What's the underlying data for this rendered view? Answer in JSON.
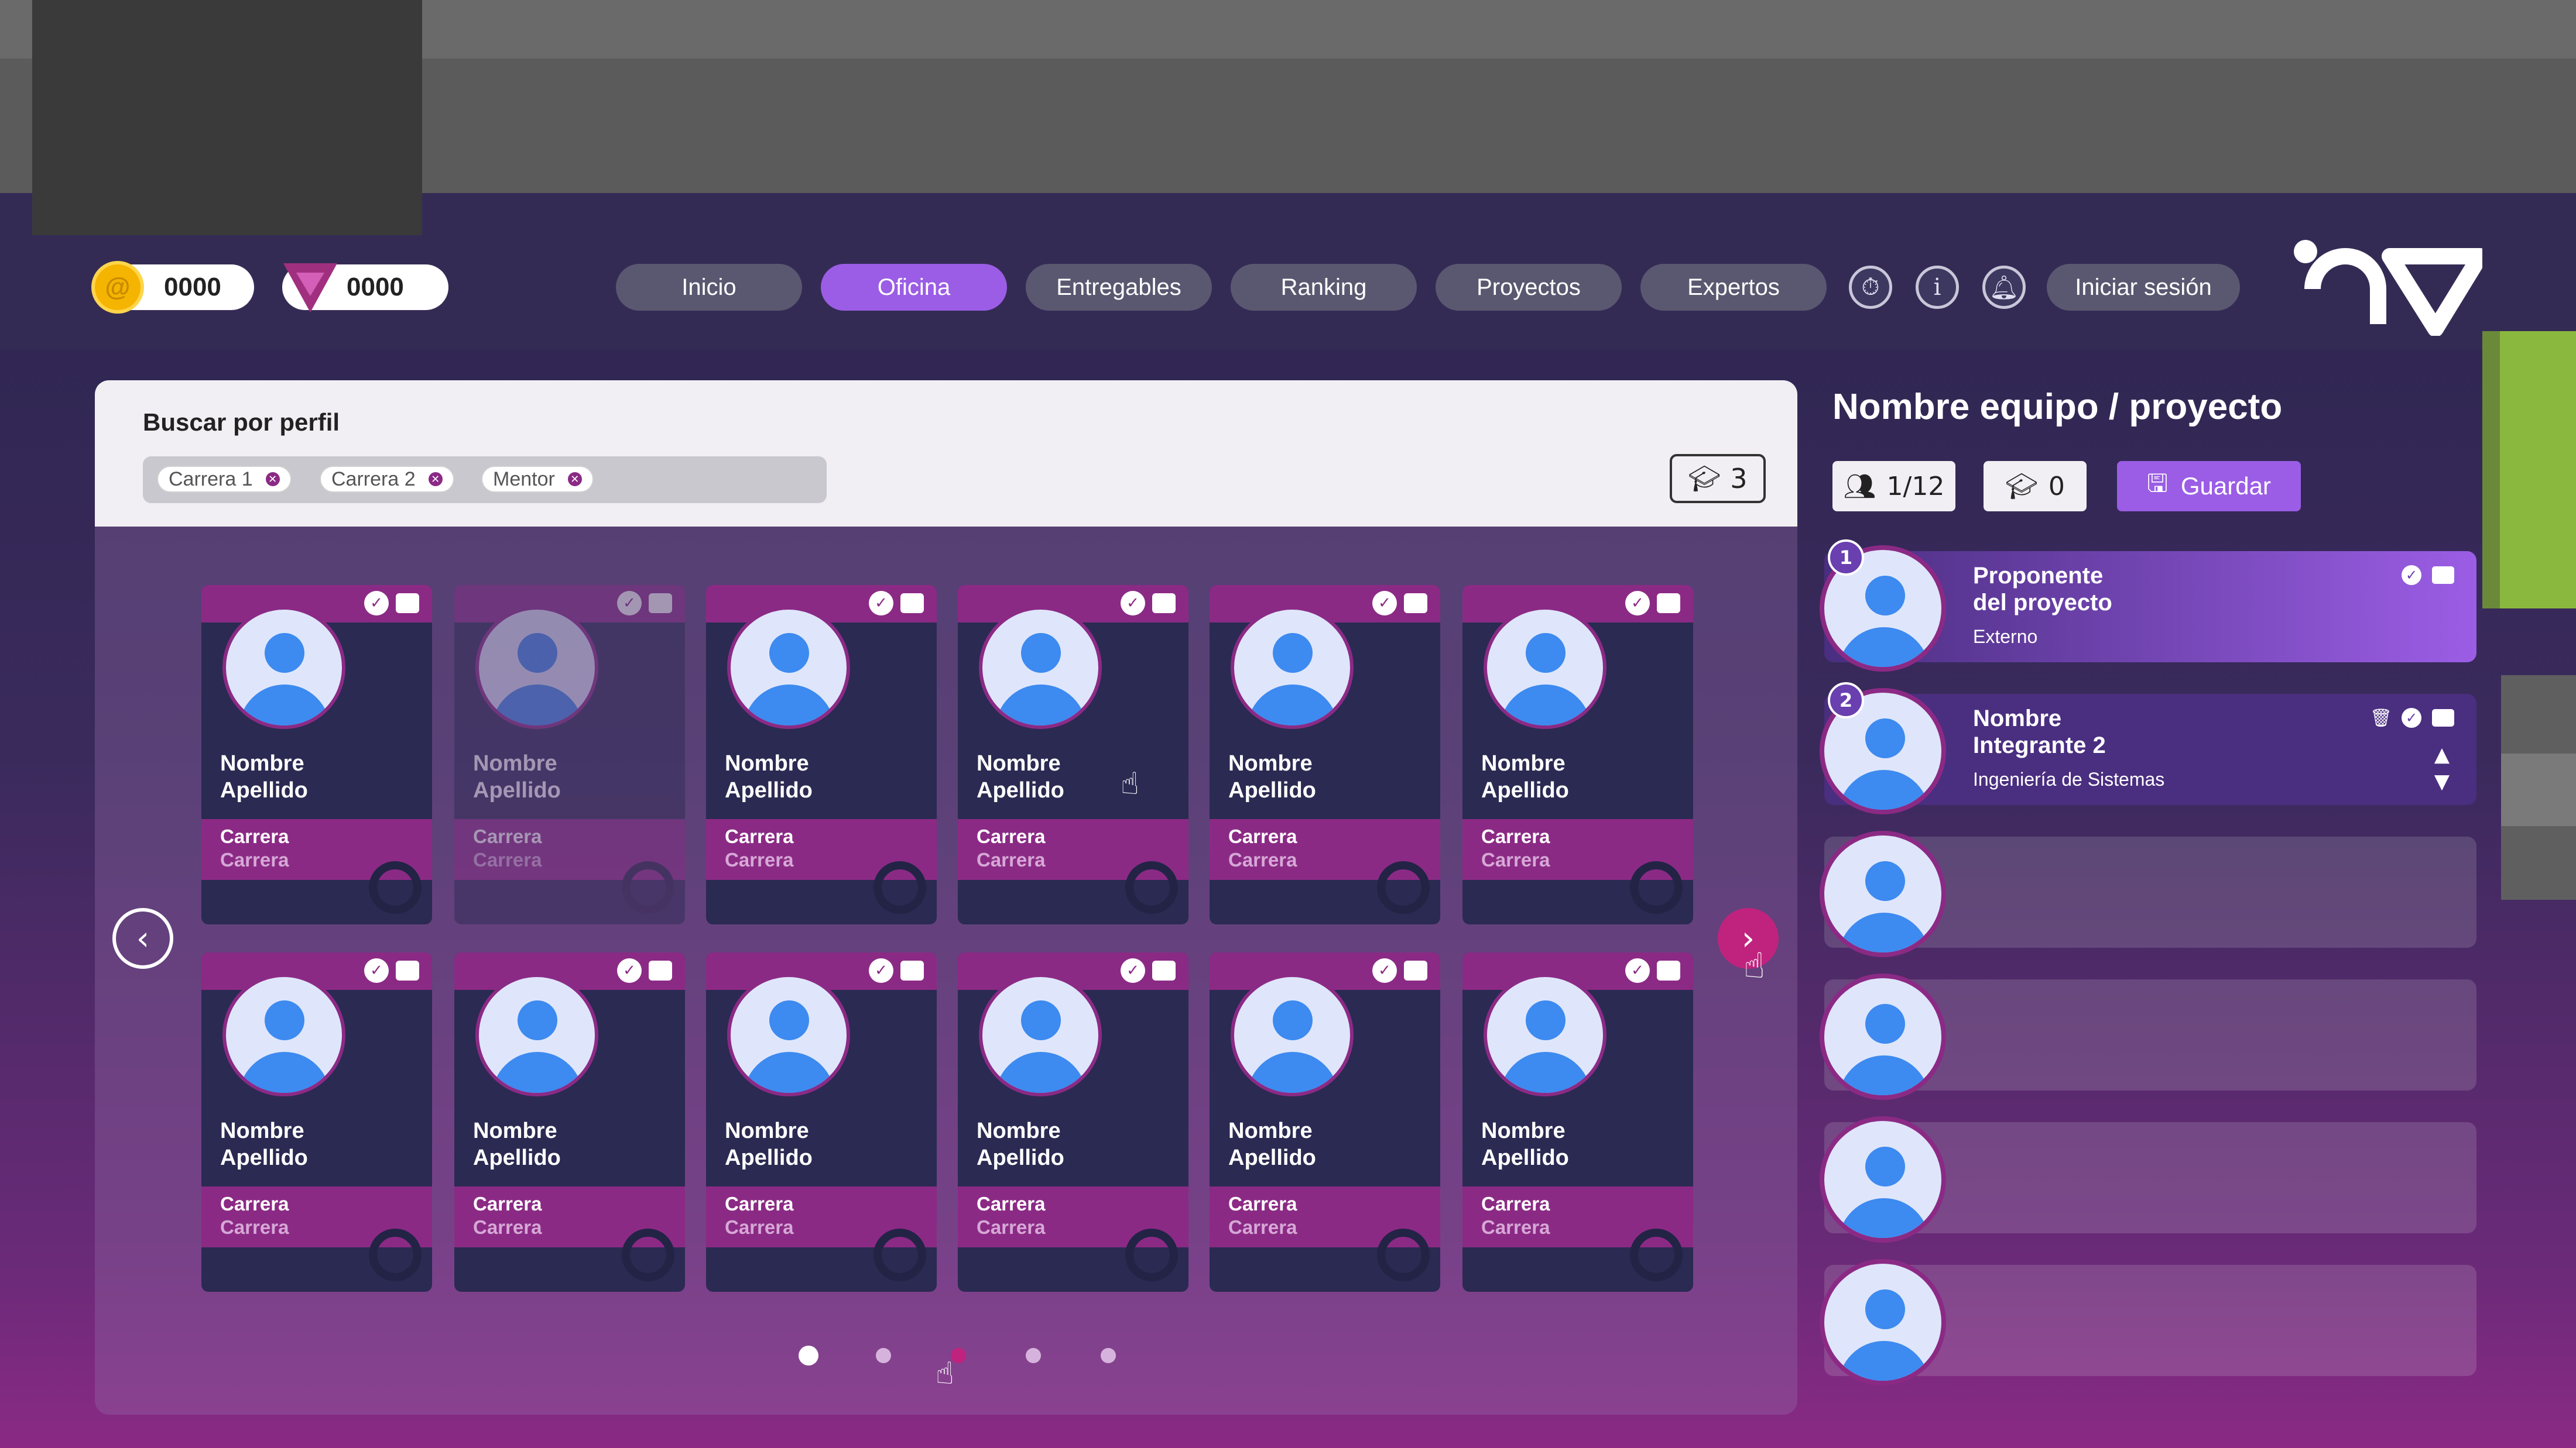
{
  "currencies": [
    {
      "icon": "coin-icon",
      "value": "0000",
      "color": "#f5b400"
    },
    {
      "icon": "triangle-gem-icon",
      "value": "0000",
      "color": "#a0307f"
    }
  ],
  "nav": {
    "items": [
      "Inicio",
      "Oficina",
      "Entregables",
      "Ranking",
      "Proyectos",
      "Expertos"
    ],
    "active": "Oficina",
    "icons": [
      "timer-icon",
      "info-icon",
      "bell-icon"
    ],
    "login": "Iniciar sesión",
    "logo": "ev-logo"
  },
  "search": {
    "title": "Buscar por perfil",
    "chips": [
      "Carrera 1",
      "Carrera 2",
      "Mentor"
    ],
    "count": "3"
  },
  "cards": [
    {
      "name1": "Nombre",
      "name2": "Apellido",
      "c1": "Carrera",
      "c2": "Carrera",
      "disabled": false
    },
    {
      "name1": "Nombre",
      "name2": "Apellido",
      "c1": "Carrera",
      "c2": "Carrera",
      "disabled": true
    },
    {
      "name1": "Nombre",
      "name2": "Apellido",
      "c1": "Carrera",
      "c2": "Carrera",
      "disabled": false
    },
    {
      "name1": "Nombre",
      "name2": "Apellido",
      "c1": "Carrera",
      "c2": "Carrera",
      "disabled": false
    },
    {
      "name1": "Nombre",
      "name2": "Apellido",
      "c1": "Carrera",
      "c2": "Carrera",
      "disabled": false
    },
    {
      "name1": "Nombre",
      "name2": "Apellido",
      "c1": "Carrera",
      "c2": "Carrera",
      "disabled": false
    },
    {
      "name1": "Nombre",
      "name2": "Apellido",
      "c1": "Carrera",
      "c2": "Carrera",
      "disabled": false
    },
    {
      "name1": "Nombre",
      "name2": "Apellido",
      "c1": "Carrera",
      "c2": "Carrera",
      "disabled": false
    },
    {
      "name1": "Nombre",
      "name2": "Apellido",
      "c1": "Carrera",
      "c2": "Carrera",
      "disabled": false
    },
    {
      "name1": "Nombre",
      "name2": "Apellido",
      "c1": "Carrera",
      "c2": "Carrera",
      "disabled": false
    },
    {
      "name1": "Nombre",
      "name2": "Apellido",
      "c1": "Carrera",
      "c2": "Carrera",
      "disabled": false
    },
    {
      "name1": "Nombre",
      "name2": "Apellido",
      "c1": "Carrera",
      "c2": "Carrera",
      "disabled": false
    }
  ],
  "pagination": {
    "pages": 5,
    "current": 3
  },
  "team": {
    "title": "Nombre equipo / proyecto",
    "members_count": "1/12",
    "mentors_count": "0",
    "save": "Guardar",
    "members": [
      {
        "num": "1",
        "line1": "Proponente",
        "line2": "del proyecto",
        "sub": "Externo"
      },
      {
        "num": "2",
        "line1": "Nombre",
        "line2": "Integrante 2",
        "sub": "Ingeniería de Sistemas"
      }
    ],
    "empty_slots": 4
  }
}
